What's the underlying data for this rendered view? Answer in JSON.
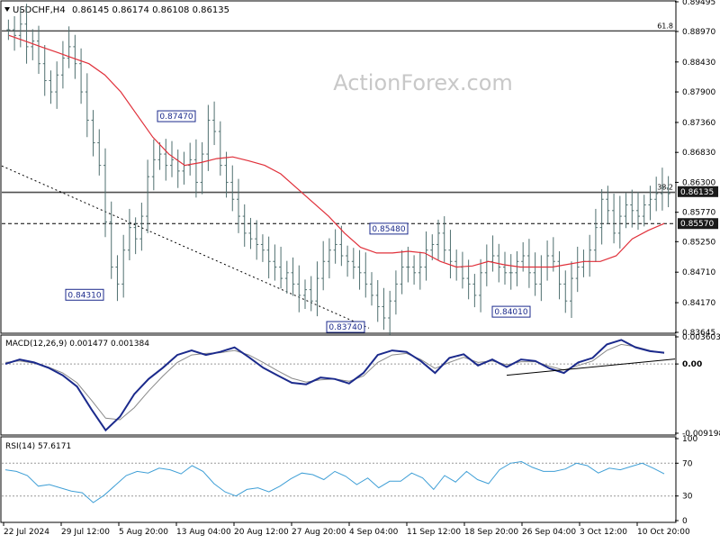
{
  "header": {
    "symbol": "USDCHF,H4",
    "ohlc": "0.86145 0.86174 0.86108 0.86135"
  },
  "watermark": "ActionForex.com",
  "colors": {
    "price_bars": "#4f6f6f",
    "ma": "#e0303a",
    "macd_line": "#1b2a8c",
    "macd_signal": "#8a8a8a",
    "rsi": "#3f9fd6",
    "frame": "#000000",
    "label_box_border": "#1b2a8c",
    "label_text": "#1b2a8c"
  },
  "chart_data": [
    {
      "type": "candlestick",
      "title": "USDCHF,H4",
      "x_tick_labels": [
        "22 Jul 2024",
        "29 Jul 12:00",
        "5 Aug 20:00",
        "13 Aug 04:00",
        "20 Aug 12:00",
        "27 Aug 20:00",
        "4 Sep 04:00",
        "11 Sep 12:00",
        "18 Sep 20:00",
        "26 Sep 04:00",
        "3 Oct 12:00",
        "10 Oct 20:00"
      ],
      "y_ticks": [
        0.89495,
        0.8897,
        0.8843,
        0.879,
        0.8736,
        0.8683,
        0.863,
        0.8577,
        0.8525,
        0.8471,
        0.8417,
        0.83645
      ],
      "ylim": [
        0.83645,
        0.89495
      ],
      "current_price": 0.86135,
      "support_level": 0.8557,
      "fib_levels": [
        {
          "label": "61.8",
          "value": 0.8898
        },
        {
          "label": "38.2",
          "value": 0.8612
        }
      ],
      "price_labels": [
        {
          "label": "0.87470",
          "value": 0.8747
        },
        {
          "label": "0.84310",
          "value": 0.8431
        },
        {
          "label": "0.85480",
          "value": 0.8548
        },
        {
          "label": "0.83740",
          "value": 0.8374
        },
        {
          "label": "0.84010",
          "value": 0.8401
        }
      ],
      "close_series": [
        0.89,
        0.889,
        0.891,
        0.887,
        0.888,
        0.884,
        0.881,
        0.879,
        0.882,
        0.885,
        0.887,
        0.884,
        0.879,
        0.874,
        0.87,
        0.866,
        0.856,
        0.848,
        0.845,
        0.851,
        0.855,
        0.853,
        0.857,
        0.864,
        0.867,
        0.868,
        0.866,
        0.867,
        0.865,
        0.866,
        0.867,
        0.863,
        0.868,
        0.874,
        0.872,
        0.866,
        0.863,
        0.86,
        0.857,
        0.854,
        0.853,
        0.852,
        0.851,
        0.849,
        0.848,
        0.846,
        0.847,
        0.845,
        0.843,
        0.844,
        0.842,
        0.846,
        0.849,
        0.851,
        0.852,
        0.85,
        0.849,
        0.848,
        0.847,
        0.845,
        0.843,
        0.841,
        0.839,
        0.842,
        0.845,
        0.848,
        0.848,
        0.847,
        0.848,
        0.851,
        0.852,
        0.854,
        0.851,
        0.849,
        0.848,
        0.846,
        0.845,
        0.843,
        0.847,
        0.849,
        0.85,
        0.848,
        0.847,
        0.847,
        0.849,
        0.85,
        0.847,
        0.845,
        0.848,
        0.85,
        0.849,
        0.845,
        0.842,
        0.846,
        0.848,
        0.849,
        0.851,
        0.855,
        0.86,
        0.858,
        0.854,
        0.857,
        0.859,
        0.858,
        0.857,
        0.859,
        0.86,
        0.861,
        0.862,
        0.861
      ],
      "ma_series": [
        0.889,
        0.888,
        0.887,
        0.886,
        0.885,
        0.884,
        0.882,
        0.879,
        0.875,
        0.871,
        0.868,
        0.866,
        0.8665,
        0.8672,
        0.8675,
        0.8668,
        0.866,
        0.8645,
        0.862,
        0.8595,
        0.857,
        0.854,
        0.8515,
        0.8505,
        0.8505,
        0.8508,
        0.8505,
        0.849,
        0.848,
        0.8482,
        0.849,
        0.8484,
        0.848,
        0.848,
        0.848,
        0.8485,
        0.849,
        0.849,
        0.85,
        0.853,
        0.8545,
        0.8557
      ],
      "macd": {
        "label": "MACD(12,26,9) 0.001477 0.001384",
        "y_ticks": [
          0.003603,
          0.0,
          -0.009198
        ],
        "ylim": [
          -0.009198,
          0.003603
        ],
        "macd_series": [
          0.0,
          0.0006,
          0.0002,
          -0.0005,
          -0.0015,
          -0.003,
          -0.006,
          -0.0088,
          -0.007,
          -0.004,
          -0.002,
          -0.0005,
          0.0012,
          0.0018,
          0.0012,
          0.0016,
          0.0022,
          0.0009,
          -0.0005,
          -0.0015,
          -0.0025,
          -0.0027,
          -0.0018,
          -0.002,
          -0.0026,
          -0.0012,
          0.0012,
          0.0018,
          0.0016,
          0.0004,
          -0.0012,
          0.0008,
          0.0013,
          -0.0002,
          0.0006,
          -0.0004,
          0.0006,
          0.0004,
          -0.0006,
          -0.0012,
          0.0002,
          0.0008,
          0.0026,
          0.0032,
          0.0022,
          0.0017,
          0.0015
        ],
        "signal_series": [
          0.0002,
          0.0004,
          0.0001,
          -0.0004,
          -0.0012,
          -0.0025,
          -0.0048,
          -0.0072,
          -0.0074,
          -0.0058,
          -0.0036,
          -0.0016,
          0.0002,
          0.0012,
          0.0014,
          0.0015,
          0.0018,
          0.0012,
          0.0002,
          -0.0009,
          -0.0019,
          -0.0024,
          -0.0021,
          -0.002,
          -0.0023,
          -0.0016,
          0.0002,
          0.0012,
          0.0014,
          0.0006,
          -0.0006,
          0.0002,
          0.0009,
          0.0002,
          0.0004,
          -0.0001,
          0.0003,
          0.0003,
          -0.0003,
          -0.0008,
          -0.0002,
          0.0004,
          0.0018,
          0.0026,
          0.0023,
          0.0018,
          0.0014
        ]
      },
      "rsi": {
        "label": "RSI(14) 57.6171",
        "y_ticks": [
          100,
          70,
          30,
          0
        ],
        "ylim": [
          0,
          100
        ],
        "levels": [
          70,
          30
        ],
        "series": [
          62,
          60,
          55,
          42,
          44,
          40,
          36,
          34,
          22,
          31,
          43,
          55,
          60,
          58,
          64,
          62,
          57,
          67,
          60,
          45,
          35,
          30,
          38,
          40,
          35,
          42,
          51,
          58,
          56,
          50,
          60,
          54,
          44,
          52,
          40,
          48,
          48,
          58,
          52,
          38,
          55,
          47,
          60,
          50,
          45,
          62,
          70,
          72,
          65,
          60,
          60,
          63,
          70,
          67,
          58,
          64,
          62,
          66,
          70,
          64,
          57
        ]
      }
    }
  ]
}
